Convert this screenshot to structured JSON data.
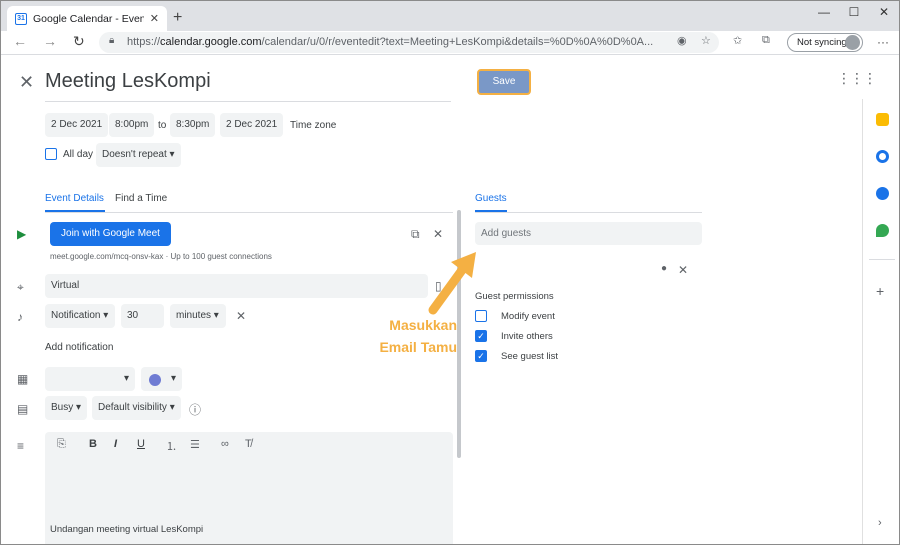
{
  "browser": {
    "tab_title": "Google Calendar - Event details",
    "tab_favicon": "31",
    "url_scheme": "https://",
    "url_host": "calendar.google.com",
    "url_path": "/calendar/u/0/r/eventedit?text=Meeting+LesKompi&details=%0D%0A%0D%0A...",
    "sync_label": "Not syncing"
  },
  "event": {
    "title": "Meeting LesKompi",
    "save_label": "Save",
    "start_date": "2 Dec 2021",
    "start_time": "8:00pm",
    "to_label": "to",
    "end_time": "8:30pm",
    "end_date": "2 Dec 2021",
    "timezone_label": "Time zone",
    "allday_label": "All day",
    "repeat_label": "Doesn't repeat"
  },
  "tabs": {
    "event_details": "Event Details",
    "find_time": "Find a Time",
    "guests": "Guests"
  },
  "details": {
    "meet_button": "Join with Google Meet",
    "meet_link": "meet.google.com/mcq-onsv-kax · Up to 100 guest connections",
    "location": "Virtual",
    "notification_type": "Notification",
    "notification_value": "30",
    "notification_unit": "minutes",
    "add_notification": "Add notification",
    "busy": "Busy",
    "visibility": "Default visibility",
    "description": "Undangan meeting virtual LesKompi"
  },
  "guests": {
    "add_placeholder": "Add guests",
    "permissions_title": "Guest permissions",
    "permissions": [
      {
        "label": "Modify event",
        "checked": false
      },
      {
        "label": "Invite others",
        "checked": true
      },
      {
        "label": "See guest list",
        "checked": true
      }
    ]
  },
  "annotation": {
    "line1": "Masukkan",
    "line2": "Email Tamu"
  },
  "colors": {
    "accent": "#1a73e8",
    "highlight": "#f4b043",
    "save_bg": "#7a98c7",
    "event_color": "#6f7cd3"
  }
}
